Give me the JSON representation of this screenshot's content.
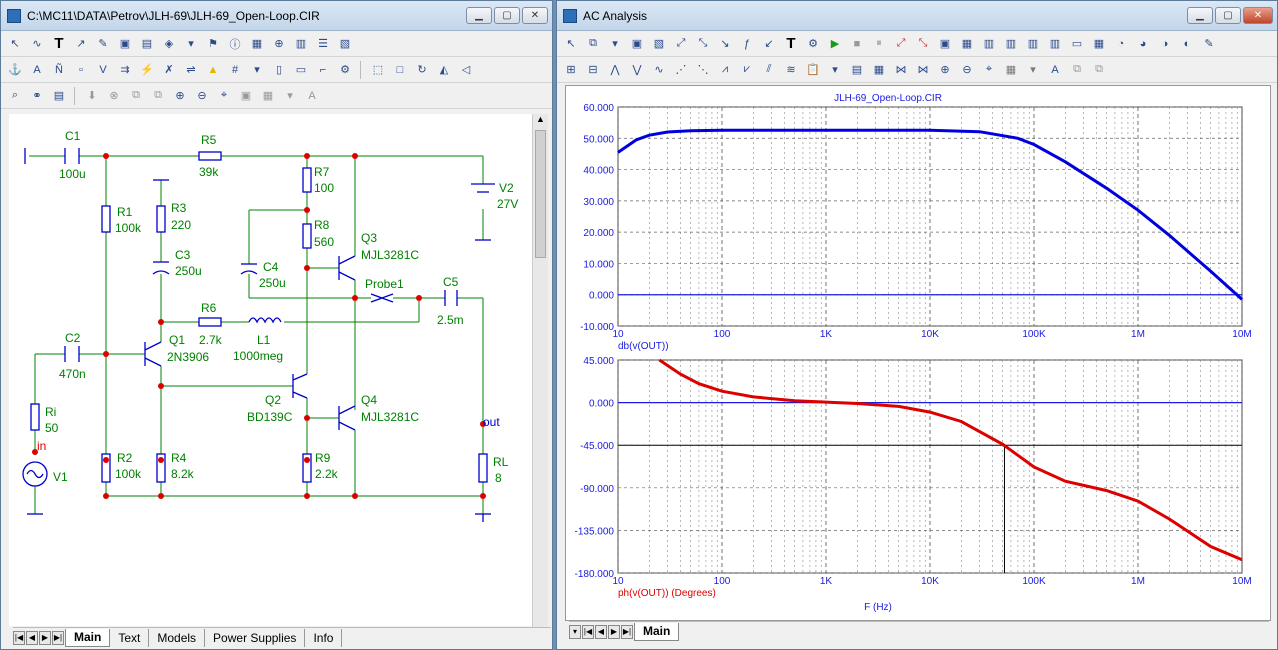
{
  "schematic": {
    "title": "C:\\MC11\\DATA\\Petrov\\JLH-69\\JLH-69_Open-Loop.CIR",
    "tabs": [
      "Main",
      "Text",
      "Models",
      "Power Supplies",
      "Info"
    ],
    "labels": {
      "c1": "C1",
      "c1v": "100u",
      "r5": "R5",
      "r5v": "39k",
      "r7": "R7",
      "r7v": "100",
      "v2": "V2",
      "v2v": "27V",
      "r1": "R1",
      "r1v": "100k",
      "r3": "R3",
      "r3v": "220",
      "r8": "R8",
      "r8v": "560",
      "q3": "Q3",
      "q3v": "MJL3281C",
      "c3": "C3",
      "c3v": "250u",
      "c4": "C4",
      "c4v": "250u",
      "probe": "Probe1",
      "c5": "C5",
      "c5v": "2.5m",
      "r6": "R6",
      "r6v": "2.7k",
      "l1": "L1",
      "l1v": "1000meg",
      "c2": "C2",
      "c2v": "470n",
      "q1": "Q1",
      "q1v": "2N3906",
      "q2": "Q2",
      "q2v": "BD139C",
      "q4": "Q4",
      "q4v": "MJL3281C",
      "ri": "Ri",
      "riv": "50",
      "in": "in",
      "out": "out",
      "v1": "V1",
      "r2": "R2",
      "r2v": "100k",
      "r4": "R4",
      "r4v": "8.2k",
      "r9": "R9",
      "r9v": "2.2k",
      "rl": "RL",
      "rlv": "8"
    }
  },
  "analysis": {
    "title": "AC Analysis",
    "tabs": [
      "Main"
    ],
    "plot_title": "JLH-69_Open-Loop.CIR",
    "top_expr": "db(v(OUT))",
    "bottom_expr": "ph(v(OUT)) (Degrees)",
    "xlabel": "F (Hz)",
    "colors": {
      "top": "#0000dd",
      "bottom": "#dd0000",
      "text": "#1a1ae0",
      "grid": "#555555"
    }
  },
  "chart_data": [
    {
      "type": "line",
      "title": "JLH-69_Open-Loop.CIR",
      "ylabel": "db(v(OUT))",
      "xlabel": "",
      "xscale": "log",
      "xlim": [
        10,
        10000000
      ],
      "ylim": [
        -10,
        60
      ],
      "yticks": [
        "60.000",
        "50.000",
        "40.000",
        "30.000",
        "20.000",
        "10.000",
        "0.000",
        "-10.000"
      ],
      "xticks": [
        "10",
        "100",
        "1K",
        "10K",
        "100K",
        "1M",
        "10M"
      ],
      "series": [
        {
          "x": [
            10,
            15,
            20,
            30,
            50,
            100,
            1000,
            10000,
            30000,
            70000,
            100000,
            200000,
            500000,
            1000000,
            2000000,
            5000000,
            10000000
          ],
          "y": [
            45.5,
            49.5,
            51.0,
            52.0,
            52.4,
            52.6,
            52.6,
            52.6,
            52.1,
            50.0,
            48.0,
            42.5,
            34.0,
            27.0,
            19.0,
            7.5,
            -1.5
          ]
        }
      ]
    },
    {
      "type": "line",
      "ylabel": "ph(v(OUT)) (Degrees)",
      "xlabel": "F (Hz)",
      "xscale": "log",
      "xlim": [
        10,
        10000000
      ],
      "ylim": [
        -180,
        45
      ],
      "yticks": [
        "45.000",
        "0.000",
        "-45.000",
        "-90.000",
        "-135.000",
        "-180.000"
      ],
      "xticks": [
        "10",
        "100",
        "1K",
        "10K",
        "100K",
        "1M",
        "10M"
      ],
      "cursor": {
        "x": 52000,
        "y": -45
      },
      "series": [
        {
          "x": [
            25,
            40,
            60,
            100,
            200,
            500,
            1000,
            2000,
            5000,
            10000,
            20000,
            50000,
            100000,
            200000,
            500000,
            1000000,
            2000000,
            5000000,
            10000000
          ],
          "y": [
            45,
            30,
            20,
            12,
            6,
            2,
            0.5,
            -1,
            -4,
            -10,
            -20,
            -44,
            -68,
            -83,
            -93,
            -104,
            -123,
            -152,
            -166
          ]
        }
      ]
    }
  ]
}
